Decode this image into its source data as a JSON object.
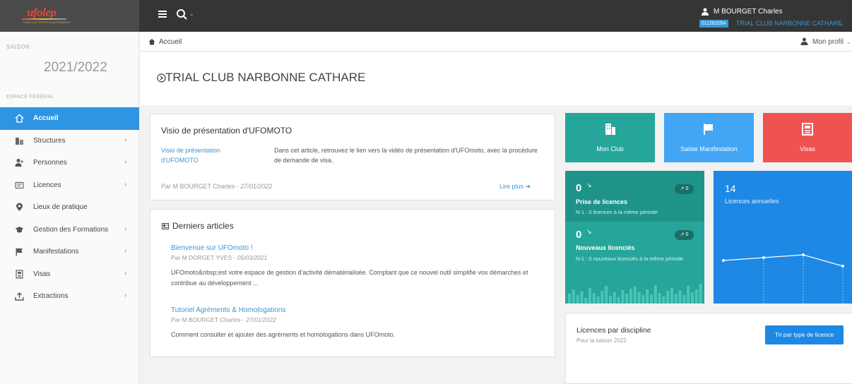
{
  "header": {
    "logo_text": "ufolep",
    "logo_sub": "TOUS LES SPORTS AUTREMENT",
    "user_name": "M BOURGET Charles",
    "club_code": "011262054",
    "club_name": "TRIAL CLUB NARBONNE CATHARE"
  },
  "sidebar": {
    "season_label": "SAISON",
    "season_value": "2021/2022",
    "space_label": "ESPACE FÉDÉRAL",
    "items": [
      {
        "label": "Accueil",
        "icon": "home-icon",
        "caret": ""
      },
      {
        "label": "Structures",
        "icon": "building-icon",
        "caret": "›"
      },
      {
        "label": "Personnes",
        "icon": "people-icon",
        "caret": "›"
      },
      {
        "label": "Licences",
        "icon": "license-icon",
        "caret": "›"
      },
      {
        "label": "Lieux de pratique",
        "icon": "location-icon",
        "caret": ""
      },
      {
        "label": "Gestion des Formations",
        "icon": "graduation-icon",
        "caret": "›"
      },
      {
        "label": "Manifestations",
        "icon": "flag-icon",
        "caret": "›"
      },
      {
        "label": "Visas",
        "icon": "document-icon",
        "caret": "›"
      },
      {
        "label": "Extractions",
        "icon": "export-icon",
        "caret": "›"
      }
    ]
  },
  "breadcrumb": {
    "home": "Accueil",
    "profile": "Mon profil"
  },
  "page_title": "TRIAL CLUB NARBONNE CATHARE",
  "visio": {
    "title": "Visio de présentation d'UFOMOTO",
    "image_alt": "Visio de présentation d'UFOMOTO",
    "description": "Dans cet article, retrouvez le lien vers la vidéo de présentation d'UFOmoto, avec la procédure de demande de visa.",
    "author": "Par M BOURGET Charles - ",
    "date": "27/01/2022",
    "read_more": "Lire plus"
  },
  "articles": {
    "title": "Derniers articles",
    "items": [
      {
        "title": "Bienvenue sur UFOmoto !",
        "author": "Par M DORGET YVES - ",
        "date": "05/03/2021",
        "text": "UFOmoto&nbsp;est votre espace de gestion d'activité dématérialisée. Comptant que ce nouvel outil simplifie vos démarches et contribue au développement ..."
      },
      {
        "title": "Tutoriel Agréments & Homologations",
        "author": "Par M BOURGET Charles - ",
        "date": "27/01/2022",
        "text": "Comment consulter et ajouter des agréments et homologations dans UFOmoto."
      }
    ]
  },
  "tiles": {
    "club": "Mon Club",
    "saisie": "Saisie Manifestation",
    "visas": "Visas"
  },
  "stats": {
    "prise": {
      "value": "0",
      "badge": "0",
      "label": "Prise de licences",
      "sub": "N-1 : 0 licences à la même période"
    },
    "nouveaux": {
      "value": "0",
      "badge": "0",
      "label": "Nouveaux licenciés",
      "sub": "N-1 : 0 nouveaux licenciés à la même période"
    },
    "annuelles": {
      "value": "14",
      "label": "Licences annuelles"
    }
  },
  "discipline": {
    "title": "Licences par discipline",
    "sub": "Pour la saison 2022",
    "button": "Tri par type de licence"
  },
  "colors": {
    "accent": "#2d95e1",
    "green": "#26a69a",
    "blue": "#42a5f5",
    "red": "#ef5350"
  }
}
